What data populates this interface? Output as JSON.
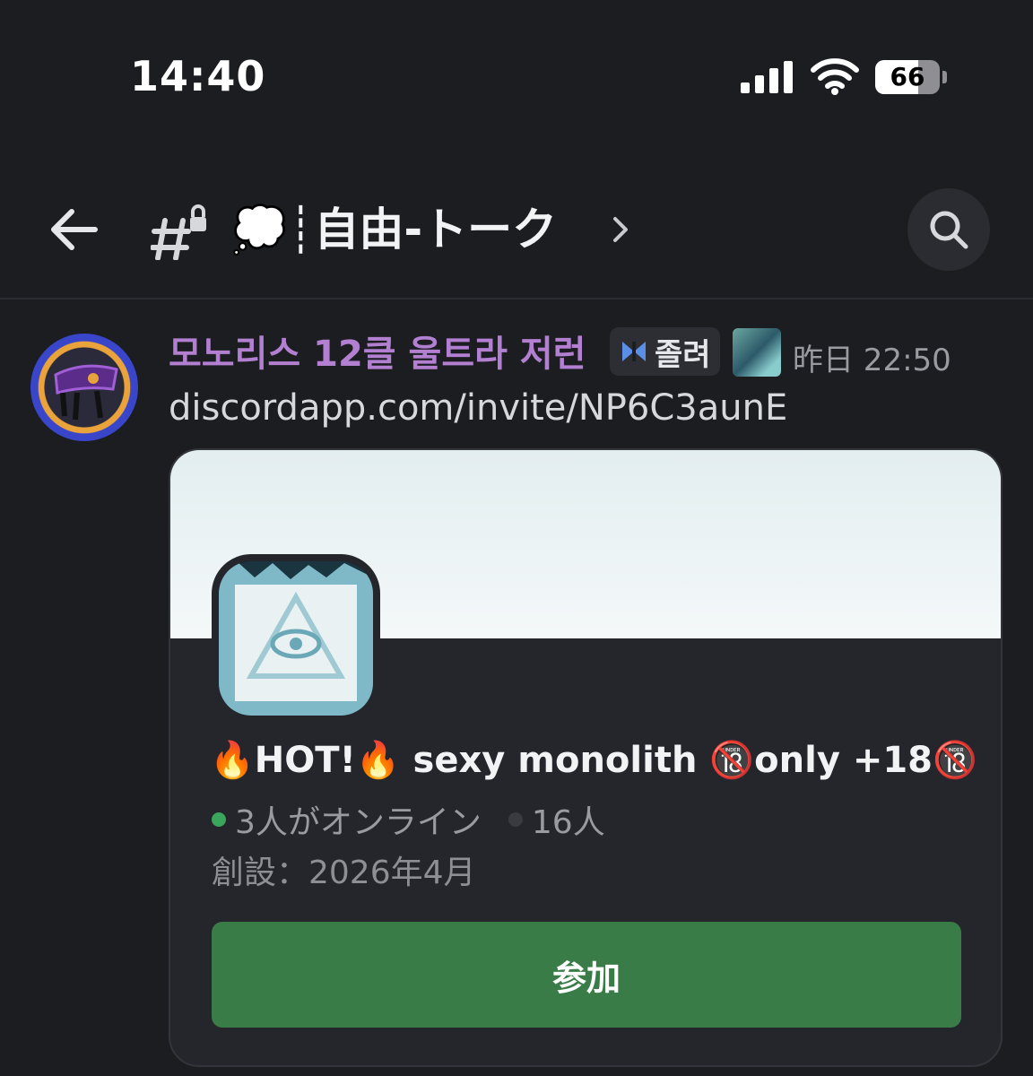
{
  "status_bar": {
    "time": "14:40",
    "battery": "66",
    "icons": [
      "cellular-signal-icon",
      "wifi-icon",
      "battery-icon"
    ]
  },
  "header": {
    "channel_name": "💭┊自由-トーク",
    "icons": [
      "back-arrow-icon",
      "locked-channel-icon",
      "chevron-right-icon",
      "search-icon"
    ]
  },
  "message": {
    "author": "모노리스 12클 울트라 저런",
    "tag": "졸려",
    "timestamp": "昨日 22:50",
    "content": "discordapp.com/invite/NP6C3aunE"
  },
  "invite": {
    "server_name": "🔥HOT!🔥 sexy monolith 🔞only +18🔞",
    "online": "3人がオンライン",
    "members": "16人",
    "founded": "創設：2026年4月",
    "join_label": "参加"
  },
  "colors": {
    "background": "#1c1d21",
    "username": "#b27fd1",
    "join_button": "#3a7c48",
    "online_dot": "#3ba55c"
  }
}
